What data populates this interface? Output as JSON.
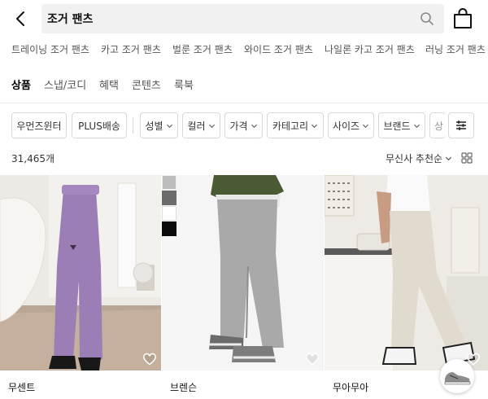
{
  "search": {
    "query": "조거 팬츠"
  },
  "related_keywords": [
    "트레이닝 조거 팬츠",
    "카고 조거 팬츠",
    "벌룬 조거 팬츠",
    "와이드 조거 팬츠",
    "나일론 카고 조거 팬츠",
    "러닝 조거 팬츠"
  ],
  "tabs": [
    {
      "label": "상품",
      "active": true
    },
    {
      "label": "스냅/코디",
      "active": false
    },
    {
      "label": "혜택",
      "active": false
    },
    {
      "label": "콘텐츠",
      "active": false
    },
    {
      "label": "룩북",
      "active": false
    }
  ],
  "filters": {
    "toggles": [
      "우먼즈윈터",
      "PLUS배송"
    ],
    "dropdowns": [
      "성별",
      "컬러",
      "가격",
      "카테고리",
      "사이즈",
      "브랜드",
      "상"
    ]
  },
  "results": {
    "count": "31,465개",
    "sort": "무신사 추천순"
  },
  "products": [
    {
      "brand": "무센트"
    },
    {
      "brand": "브렌슨"
    },
    {
      "brand": "무아무아"
    }
  ],
  "swatch_colors": [
    "#bdbdbd",
    "#6b6b6b",
    "#ffffff",
    "#0a0a0a"
  ],
  "icons": {
    "back": "chevron-left-icon",
    "search": "search-icon",
    "bag": "shopping-bag-icon",
    "filter": "sliders-icon",
    "grid": "grid-view-icon",
    "wishlist": "heart-icon"
  }
}
